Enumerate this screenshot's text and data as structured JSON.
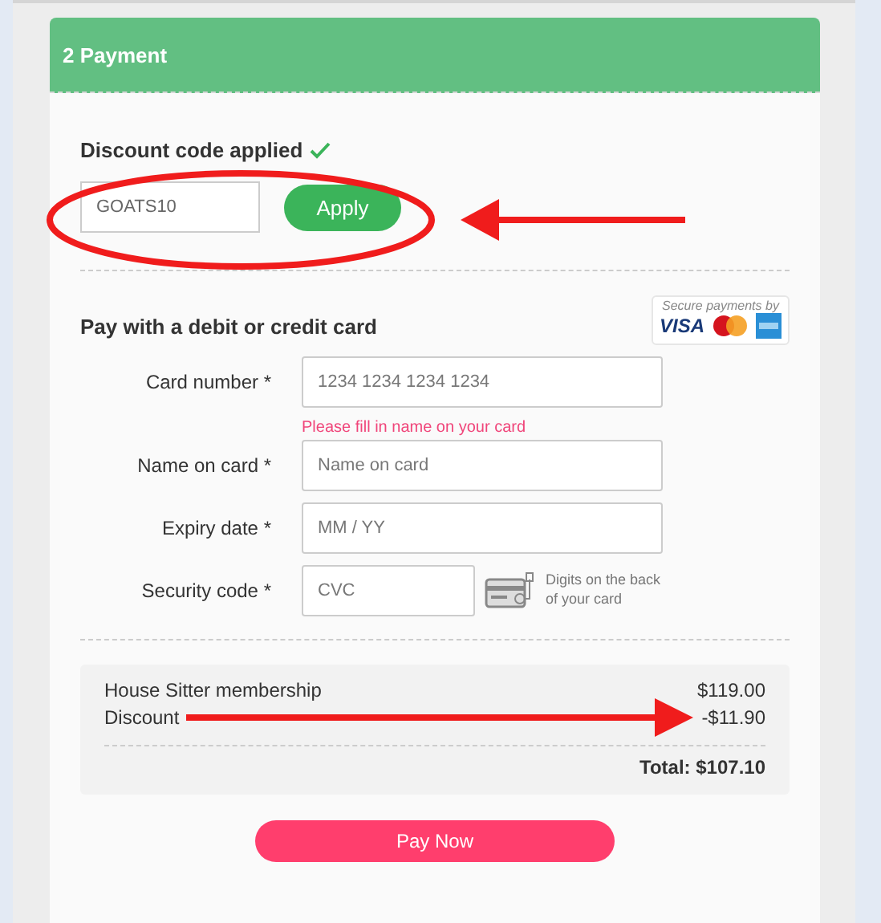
{
  "section": {
    "title": "2 Payment"
  },
  "discount": {
    "status": "Discount code applied",
    "applied": true,
    "code": "GOATS10",
    "button": "Apply"
  },
  "card_section": {
    "title": "Pay with a debit or credit card",
    "secure_note": "Secure payments by",
    "brand": "VISA"
  },
  "fields": [
    {
      "label": "Card number *",
      "placeholder": "1234 1234 1234 1234",
      "kind": "wide"
    },
    {
      "label": "Name on card *",
      "placeholder": "Name on card",
      "kind": "wide",
      "error": "Please fill in name on your card"
    },
    {
      "label": "Expiry date *",
      "placeholder": "MM / YY",
      "kind": "wide"
    },
    {
      "label": "Security code *",
      "placeholder": "CVC",
      "kind": "cvc",
      "hint": "Digits on the back of your card"
    }
  ],
  "summary": {
    "lines": [
      {
        "label": "House Sitter membership",
        "amount": "$119.00"
      },
      {
        "label": "Discount",
        "amount": "-$11.90"
      }
    ],
    "total": "Total: $107.10"
  },
  "pay_button": "Pay Now"
}
